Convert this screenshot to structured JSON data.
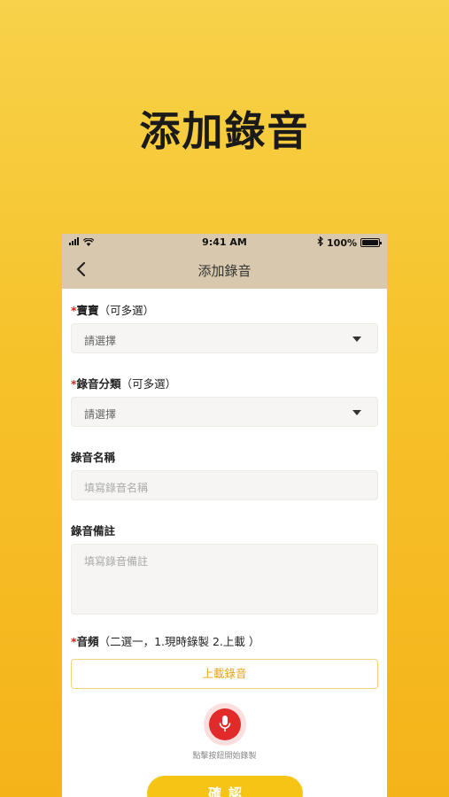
{
  "hero": {
    "title": "添加錄音"
  },
  "status_bar": {
    "time": "9:41 AM",
    "battery": "100%"
  },
  "nav": {
    "title": "添加錄音"
  },
  "form": {
    "baby": {
      "required": "*",
      "label": "寶寶",
      "hint": "（可多選）",
      "value": "請選擇"
    },
    "category": {
      "required": "*",
      "label": "錄音分類",
      "hint": "（可多選）",
      "value": "請選擇"
    },
    "name": {
      "label": "錄音名稱",
      "placeholder": "填寫錄音名稱"
    },
    "note": {
      "label": "錄音備註",
      "placeholder": "填寫錄音備註"
    },
    "audio": {
      "required": "*",
      "label": "音頻",
      "hint": "（二選一，1.現時錄製 2.上載 ）",
      "upload_label": "上載錄音"
    }
  },
  "record": {
    "hint": "點擊按鈕開始錄製"
  },
  "confirm_label": "確認",
  "colors": {
    "accent": "#f5c414",
    "header": "#d8c8ad",
    "record": "#e12a2a"
  },
  "icons": [
    "signal-icon",
    "wifi-icon",
    "bluetooth-icon",
    "battery-icon",
    "back-icon",
    "caret-down-icon",
    "microphone-icon"
  ]
}
